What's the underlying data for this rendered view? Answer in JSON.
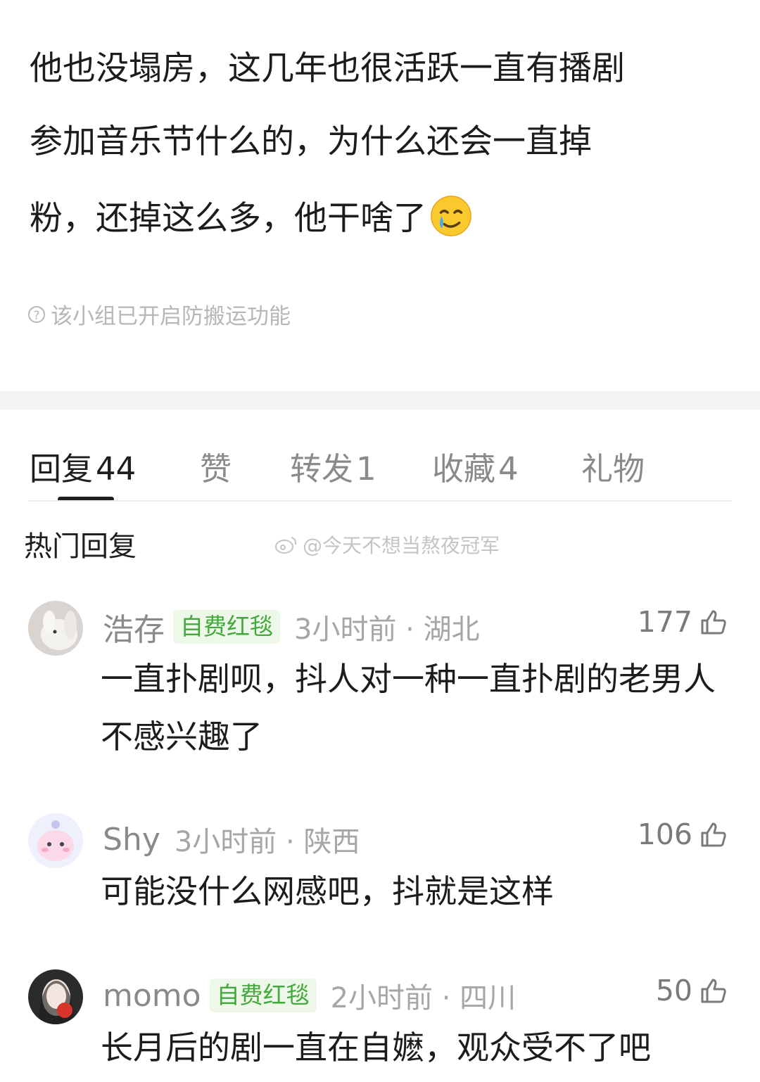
{
  "post": {
    "lines": [
      "他也没塌房，这几年也很活跃一直有播剧",
      "参加音乐节什么的，为什么还会一直掉",
      "粉，还掉这么多，他干啥了"
    ],
    "emoji": "crying-smile-emoji",
    "notice": "该小组已开启防搬运功能"
  },
  "tabs": [
    {
      "label": "回复",
      "count": "44",
      "active": true
    },
    {
      "label": "赞",
      "count": ""
    },
    {
      "label": "转发",
      "count": "1"
    },
    {
      "label": "收藏",
      "count": "4"
    },
    {
      "label": "礼物",
      "count": ""
    }
  ],
  "section_title": "热门回复",
  "watermark": "@今天不想当熬夜冠军",
  "comments": [
    {
      "username": "浩存",
      "badge": "自费红毯",
      "time_location": "3小时前 · 湖北",
      "likes": "177",
      "text": "一直扑剧呗，抖人对一种一直扑剧的老男人不感兴趣了"
    },
    {
      "username": "Shy",
      "badge": "",
      "time_location": "3小时前 · 陕西",
      "likes": "106",
      "text": "可能没什么网感吧，抖就是这样"
    },
    {
      "username": "momo",
      "badge": "自费红毯",
      "time_location": "2小时前 · 四川",
      "likes": "50",
      "text": "长月后的剧一直在自嬷，观众受不了吧"
    }
  ],
  "colors": {
    "badge_green": "#43a83d",
    "badge_bg": "#eef8e8",
    "muted": "#8a8a8a"
  }
}
